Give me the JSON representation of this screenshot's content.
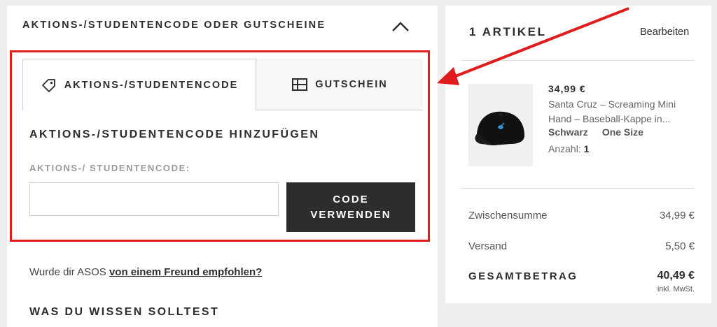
{
  "promo_section": {
    "title": "AKTIONS-/STUDENTENCODE ODER GUTSCHEINE",
    "toggle_icon": "chevron-up-icon",
    "tabs": [
      {
        "label": "AKTIONS-/STUDENTENCODE",
        "icon": "tag-icon",
        "active": true
      },
      {
        "label": "GUTSCHEIN",
        "icon": "voucher-card-icon",
        "active": false
      }
    ],
    "form_title": "AKTIONS-/STUDENTENCODE HINZUFÜGEN",
    "field_label": "AKTIONS-/ STUDENTENCODE:",
    "input_value": "",
    "button_line1": "CODE",
    "button_line2": "VERWENDEN",
    "referral_text": "Wurde dir ASOS",
    "referral_link": "von einem Freund empfohlen?",
    "info_title": "WAS DU WISSEN SOLLTEST"
  },
  "bag": {
    "count_label": "1 ARTIKEL",
    "edit_label": "Bearbeiten",
    "item": {
      "price": "34,99 €",
      "name_line1": "Santa Cruz – Screaming Mini",
      "name_line2": "Hand – Baseball-Kappe in...",
      "color": "Schwarz",
      "size": "One Size",
      "qty_label": "Anzahl:",
      "qty_value": "1"
    },
    "subtotal_label": "Zwischensumme",
    "subtotal_value": "34,99 €",
    "shipping_label": "Versand",
    "shipping_value": "5,50 €",
    "total_label": "GESAMTBETRAG",
    "total_value": "40,49 €",
    "tax_note": "inkl. MwSt."
  },
  "colors": {
    "highlight_red": "#e01c1c",
    "button_dark": "#2d2d2d",
    "page_bg": "#eeeeee"
  }
}
